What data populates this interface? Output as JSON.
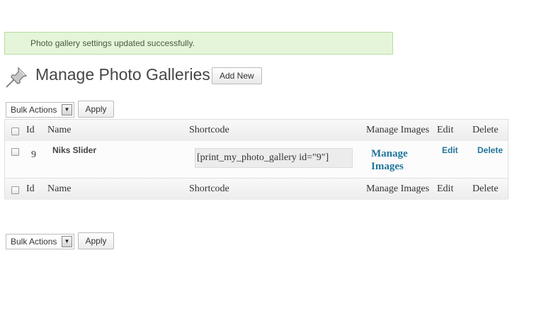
{
  "notice": {
    "message": "Photo gallery settings updated successfully."
  },
  "header": {
    "title": "Manage Photo Galleries",
    "add_new_label": "Add New"
  },
  "bulk_top": {
    "selected": "Bulk Actions",
    "apply_label": "Apply"
  },
  "bulk_bottom": {
    "selected": "Bulk Actions",
    "apply_label": "Apply"
  },
  "table": {
    "columns": {
      "id": "Id",
      "name": "Name",
      "shortcode": "Shortcode",
      "manage": "Manage Images",
      "edit": "Edit",
      "delete": "Delete"
    },
    "rows": [
      {
        "id": "9",
        "name": "Niks Slider",
        "shortcode": "[print_my_photo_gallery id=\"9\"]",
        "manage": "Manage Images",
        "edit": "Edit",
        "delete": "Delete"
      }
    ]
  },
  "colors": {
    "notice_bg": "#e5f5d9",
    "notice_border": "#b7dea1",
    "link": "#21759b"
  },
  "icons": {
    "page": "pushpin-icon",
    "dropdown": "dropdown-arrow-icon"
  }
}
